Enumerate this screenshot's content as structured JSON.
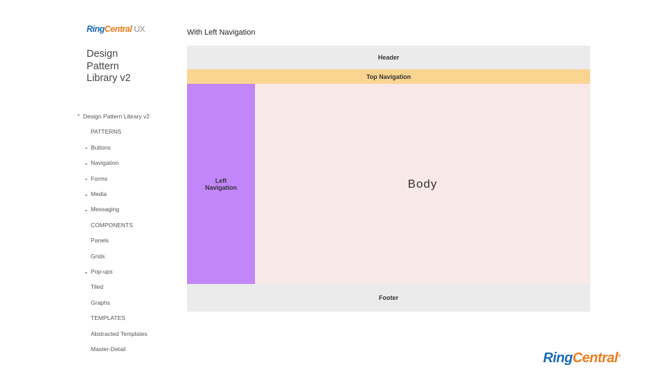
{
  "sidebar": {
    "logo_ring": "Ring",
    "logo_central": "Central",
    "logo_suffix": "UX",
    "title_lines": [
      "Design",
      "Pattern",
      "Library v2"
    ],
    "items": [
      {
        "label": "Design Pattern Library v2",
        "chevron": "up"
      },
      {
        "label": "PATTERNS",
        "chevron": ""
      },
      {
        "label": "Buttons",
        "chevron": "down"
      },
      {
        "label": "Navigation",
        "chevron": "down"
      },
      {
        "label": "Forms",
        "chevron": "down"
      },
      {
        "label": "Media",
        "chevron": "down"
      },
      {
        "label": "Messaging",
        "chevron": "down"
      },
      {
        "label": "COMPONENTS",
        "chevron": ""
      },
      {
        "label": "Panels",
        "chevron": ""
      },
      {
        "label": "Grids",
        "chevron": ""
      },
      {
        "label": "Pop-ups",
        "chevron": "down"
      },
      {
        "label": "Tiled",
        "chevron": ""
      },
      {
        "label": "Graphs",
        "chevron": ""
      },
      {
        "label": "TEMPLATES",
        "chevron": ""
      },
      {
        "label": "Abstracted Templates",
        "chevron": ""
      },
      {
        "label": "Master-Detail",
        "chevron": ""
      }
    ]
  },
  "main": {
    "title": "With Left Navigation",
    "header": "Header",
    "top_nav": "Top Navigation",
    "left_nav_1": "Left",
    "left_nav_2": "Navigation",
    "body": "Body",
    "footer": "Footer"
  },
  "footer_logo": {
    "ring": "Ring",
    "central": "Central",
    "mark": "®"
  },
  "colors": {
    "header": "#ebebeb",
    "top_nav": "#fad592",
    "left_nav": "#c386f9",
    "body": "#f9e8e8",
    "footer": "#ebebeb"
  }
}
